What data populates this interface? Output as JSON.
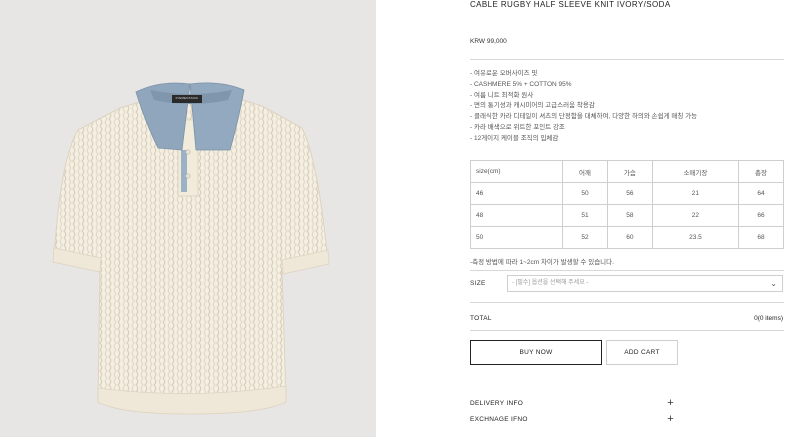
{
  "product": {
    "title": "CABLE RUGBY HALF SLEEVE KNIT IVORY/SODA",
    "price": "KRW 99,000",
    "image_label": "PIGMENTANIC",
    "description": [
      "- 여유로운 오버사이즈 핏",
      "- CASHMERE 5% + COTTON 95%",
      "- 여름 니트 최적화 원사",
      "- 면의 통기성과 캐시미어의 고급스러움 착용감",
      "- 클래식한 카라 디테일이 셔츠의 단정함을 대체하여, 다양한 하의와 손쉽게 매칭 가능",
      "- 카라 배색으로 위트한 포인트 강조",
      "- 12게이지 케이블 조직의 입체감"
    ]
  },
  "size_table": {
    "headers": [
      "size(cm)",
      "어깨",
      "가슴",
      "소매기장",
      "총장"
    ],
    "rows": [
      [
        "46",
        "50",
        "56",
        "21",
        "64"
      ],
      [
        "48",
        "51",
        "58",
        "22",
        "66"
      ],
      [
        "50",
        "52",
        "60",
        "23.5",
        "68"
      ]
    ]
  },
  "measure_note": "-측정 방법에 따라 1~2cm 차이가 발생할 수 있습니다.",
  "options": {
    "size_label": "SIZE",
    "size_placeholder": "- [필수] 옵션을 선택해 주세요 -"
  },
  "total": {
    "label": "TOTAL",
    "value": "0(0 items)"
  },
  "buttons": {
    "buy_now": "BUY NOW",
    "add_cart": "ADD CART"
  },
  "accordion": [
    {
      "label": "DELIVERY INFO",
      "icon": "plus-icon"
    },
    {
      "label": "EXCHNAGE IFNO",
      "icon": "plus-icon"
    }
  ],
  "colors": {
    "knit": "#f4efe2",
    "collar": "#8fa6bd",
    "background": "#e7e6e4"
  }
}
